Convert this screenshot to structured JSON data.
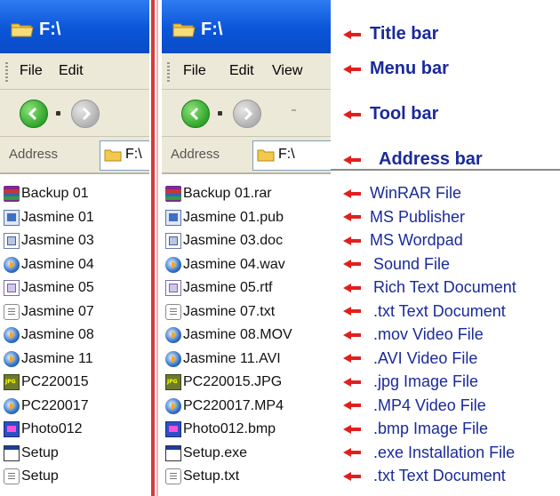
{
  "left_window": {
    "title": "F:\\",
    "menu": [
      "File",
      "Edit"
    ],
    "address_label": "Address",
    "address_value": "F:\\",
    "files": [
      {
        "name": "Backup 01",
        "icon": "winrar-icon"
      },
      {
        "name": "Jasmine 01",
        "icon": "publisher-icon"
      },
      {
        "name": "Jasmine 03",
        "icon": "wordpad-icon"
      },
      {
        "name": "Jasmine 04",
        "icon": "media-icon"
      },
      {
        "name": "Jasmine 05",
        "icon": "rtf-icon"
      },
      {
        "name": "Jasmine 07",
        "icon": "text-icon"
      },
      {
        "name": "Jasmine 08",
        "icon": "media-icon"
      },
      {
        "name": "Jasmine 11",
        "icon": "media-icon"
      },
      {
        "name": "PC220015",
        "icon": "jpg-icon"
      },
      {
        "name": "PC220017",
        "icon": "media-icon"
      },
      {
        "name": "Photo012",
        "icon": "bmp-icon"
      },
      {
        "name": "Setup",
        "icon": "exe-icon"
      },
      {
        "name": "Setup",
        "icon": "text-icon"
      }
    ]
  },
  "right_window": {
    "title": "F:\\",
    "menu": [
      "File",
      "Edit",
      "View"
    ],
    "address_label": "Address",
    "address_value": "F:\\",
    "files": [
      {
        "name": "Backup 01.rar",
        "icon": "winrar-icon"
      },
      {
        "name": "Jasmine 01.pub",
        "icon": "publisher-icon"
      },
      {
        "name": "Jasmine 03.doc",
        "icon": "wordpad-icon"
      },
      {
        "name": "Jasmine 04.wav",
        "icon": "media-icon"
      },
      {
        "name": "Jasmine 05.rtf",
        "icon": "rtf-icon"
      },
      {
        "name": "Jasmine 07.txt",
        "icon": "text-icon"
      },
      {
        "name": "Jasmine 08.MOV",
        "icon": "media-icon"
      },
      {
        "name": "Jasmine 11.AVI",
        "icon": "media-icon"
      },
      {
        "name": "PC220015.JPG",
        "icon": "jpg-icon"
      },
      {
        "name": "PC220017.MP4",
        "icon": "media-icon"
      },
      {
        "name": "Photo012.bmp",
        "icon": "bmp-icon"
      },
      {
        "name": "Setup.exe",
        "icon": "exe-icon"
      },
      {
        "name": "Setup.txt",
        "icon": "text-icon"
      }
    ]
  },
  "annotations": {
    "bars": [
      "Title bar",
      "Menu bar",
      "Tool bar",
      "Address bar"
    ],
    "files": [
      "WinRAR File",
      "MS Publisher",
      "MS Wordpad",
      "Sound File",
      "Rich Text Document",
      ".txt Text Document",
      ".mov Video File",
      ".AVI Video File",
      ".jpg Image File",
      ".MP4 Video File",
      ".bmp Image File",
      ".exe Installation File",
      ".txt Text Document"
    ]
  },
  "colors": {
    "titlebar_blue": "#0a55d8",
    "annotation_text": "#1a2a9a",
    "arrow_red": "#e01f1f",
    "chrome_beige": "#ece9d8"
  }
}
